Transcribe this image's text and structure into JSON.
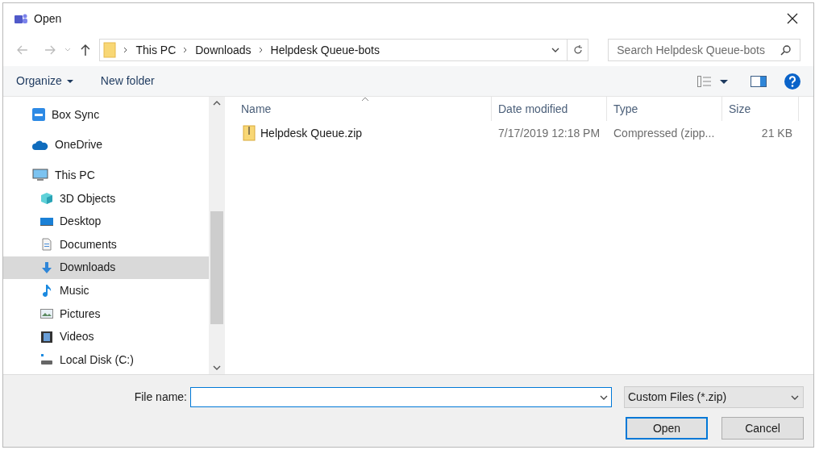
{
  "window": {
    "title": "Open"
  },
  "breadcrumb": [
    "This PC",
    "Downloads",
    "Helpdesk Queue-bots"
  ],
  "search": {
    "placeholder": "Search Helpdesk Queue-bots"
  },
  "toolbar": {
    "organize": "Organize",
    "new_folder": "New folder"
  },
  "sidebar": {
    "items": [
      {
        "label": "Box Sync",
        "selected": false
      },
      {
        "label": "OneDrive",
        "selected": false
      },
      {
        "label": "This PC",
        "selected": false,
        "children": [
          {
            "label": "3D Objects",
            "selected": false
          },
          {
            "label": "Desktop",
            "selected": false
          },
          {
            "label": "Documents",
            "selected": false
          },
          {
            "label": "Downloads",
            "selected": true
          },
          {
            "label": "Music",
            "selected": false
          },
          {
            "label": "Pictures",
            "selected": false
          },
          {
            "label": "Videos",
            "selected": false
          },
          {
            "label": "Local Disk (C:)",
            "selected": false
          }
        ]
      }
    ]
  },
  "table": {
    "columns": [
      "Name",
      "Date modified",
      "Type",
      "Size"
    ],
    "rows": [
      {
        "cells": [
          "Helpdesk Queue.zip",
          "7/17/2019 12:18 PM",
          "Compressed (zipp...",
          "21 KB"
        ]
      }
    ]
  },
  "file_name": {
    "label": "File name:"
  },
  "file_type": {
    "value": "Custom Files (*.zip)"
  },
  "buttons": [
    "Open",
    "Cancel"
  ]
}
